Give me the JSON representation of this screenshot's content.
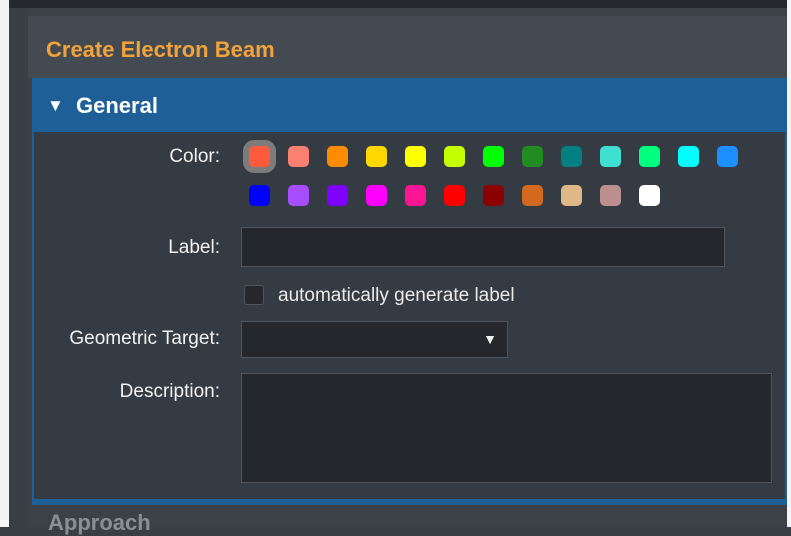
{
  "panel": {
    "title": "Create Electron Beam"
  },
  "general": {
    "header_icon": "triangle-down-icon",
    "title": "General",
    "color": {
      "label": "Color:",
      "selected_index": 0,
      "swatches": [
        "#ff5a3c",
        "#fa8072",
        "#ff8c00",
        "#ffd700",
        "#ffff00",
        "#c4ff00",
        "#00ff00",
        "#228b22",
        "#008080",
        "#40e0d0",
        "#00ff7f",
        "#00ffff",
        "#1e8fff",
        "#0000ff",
        "#a64dff",
        "#8000ff",
        "#ff00ff",
        "#ff1493",
        "#ff0000",
        "#8b0000",
        "#d2691e",
        "#deb887",
        "#bc8f8f",
        "#ffffff"
      ]
    },
    "label_field": {
      "label": "Label:",
      "value": ""
    },
    "auto_label": {
      "text": "automatically generate label",
      "checked": false
    },
    "geometric_target": {
      "label": "Geometric Target:",
      "value": "",
      "arrow_icon": "caret-down-icon"
    },
    "description": {
      "label": "Description:",
      "value": ""
    }
  },
  "next_section": {
    "title": "Approach"
  }
}
